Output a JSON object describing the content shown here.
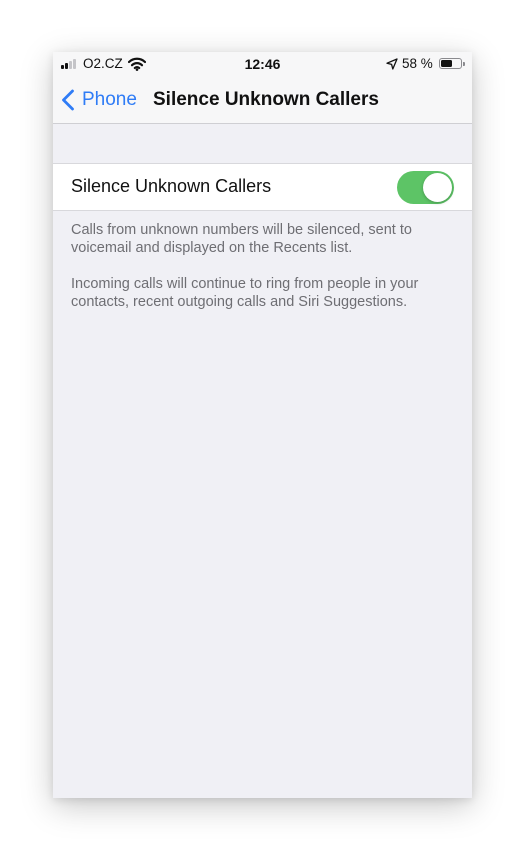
{
  "status_bar": {
    "carrier": "O2.CZ",
    "time": "12:46",
    "battery_percent_label": "58 %",
    "battery_level": 0.58,
    "signal_bars": 2,
    "icons": [
      "signal-icon",
      "wifi-icon",
      "location-arrow-icon",
      "battery-icon"
    ]
  },
  "nav": {
    "back_label": "Phone",
    "title": "Silence Unknown Callers"
  },
  "setting": {
    "label": "Silence Unknown Callers",
    "enabled": true
  },
  "footer": {
    "paragraph_1": "Calls from unknown numbers will be silenced, sent to voicemail and displayed on the Recents list.",
    "paragraph_2": "Incoming calls will continue to ring from people in your contacts, recent outgoing calls and Siri Suggestions."
  },
  "colors": {
    "accent": "#2f7cf6",
    "toggle_on": "#5dc466",
    "background": "#f0f0f5"
  }
}
